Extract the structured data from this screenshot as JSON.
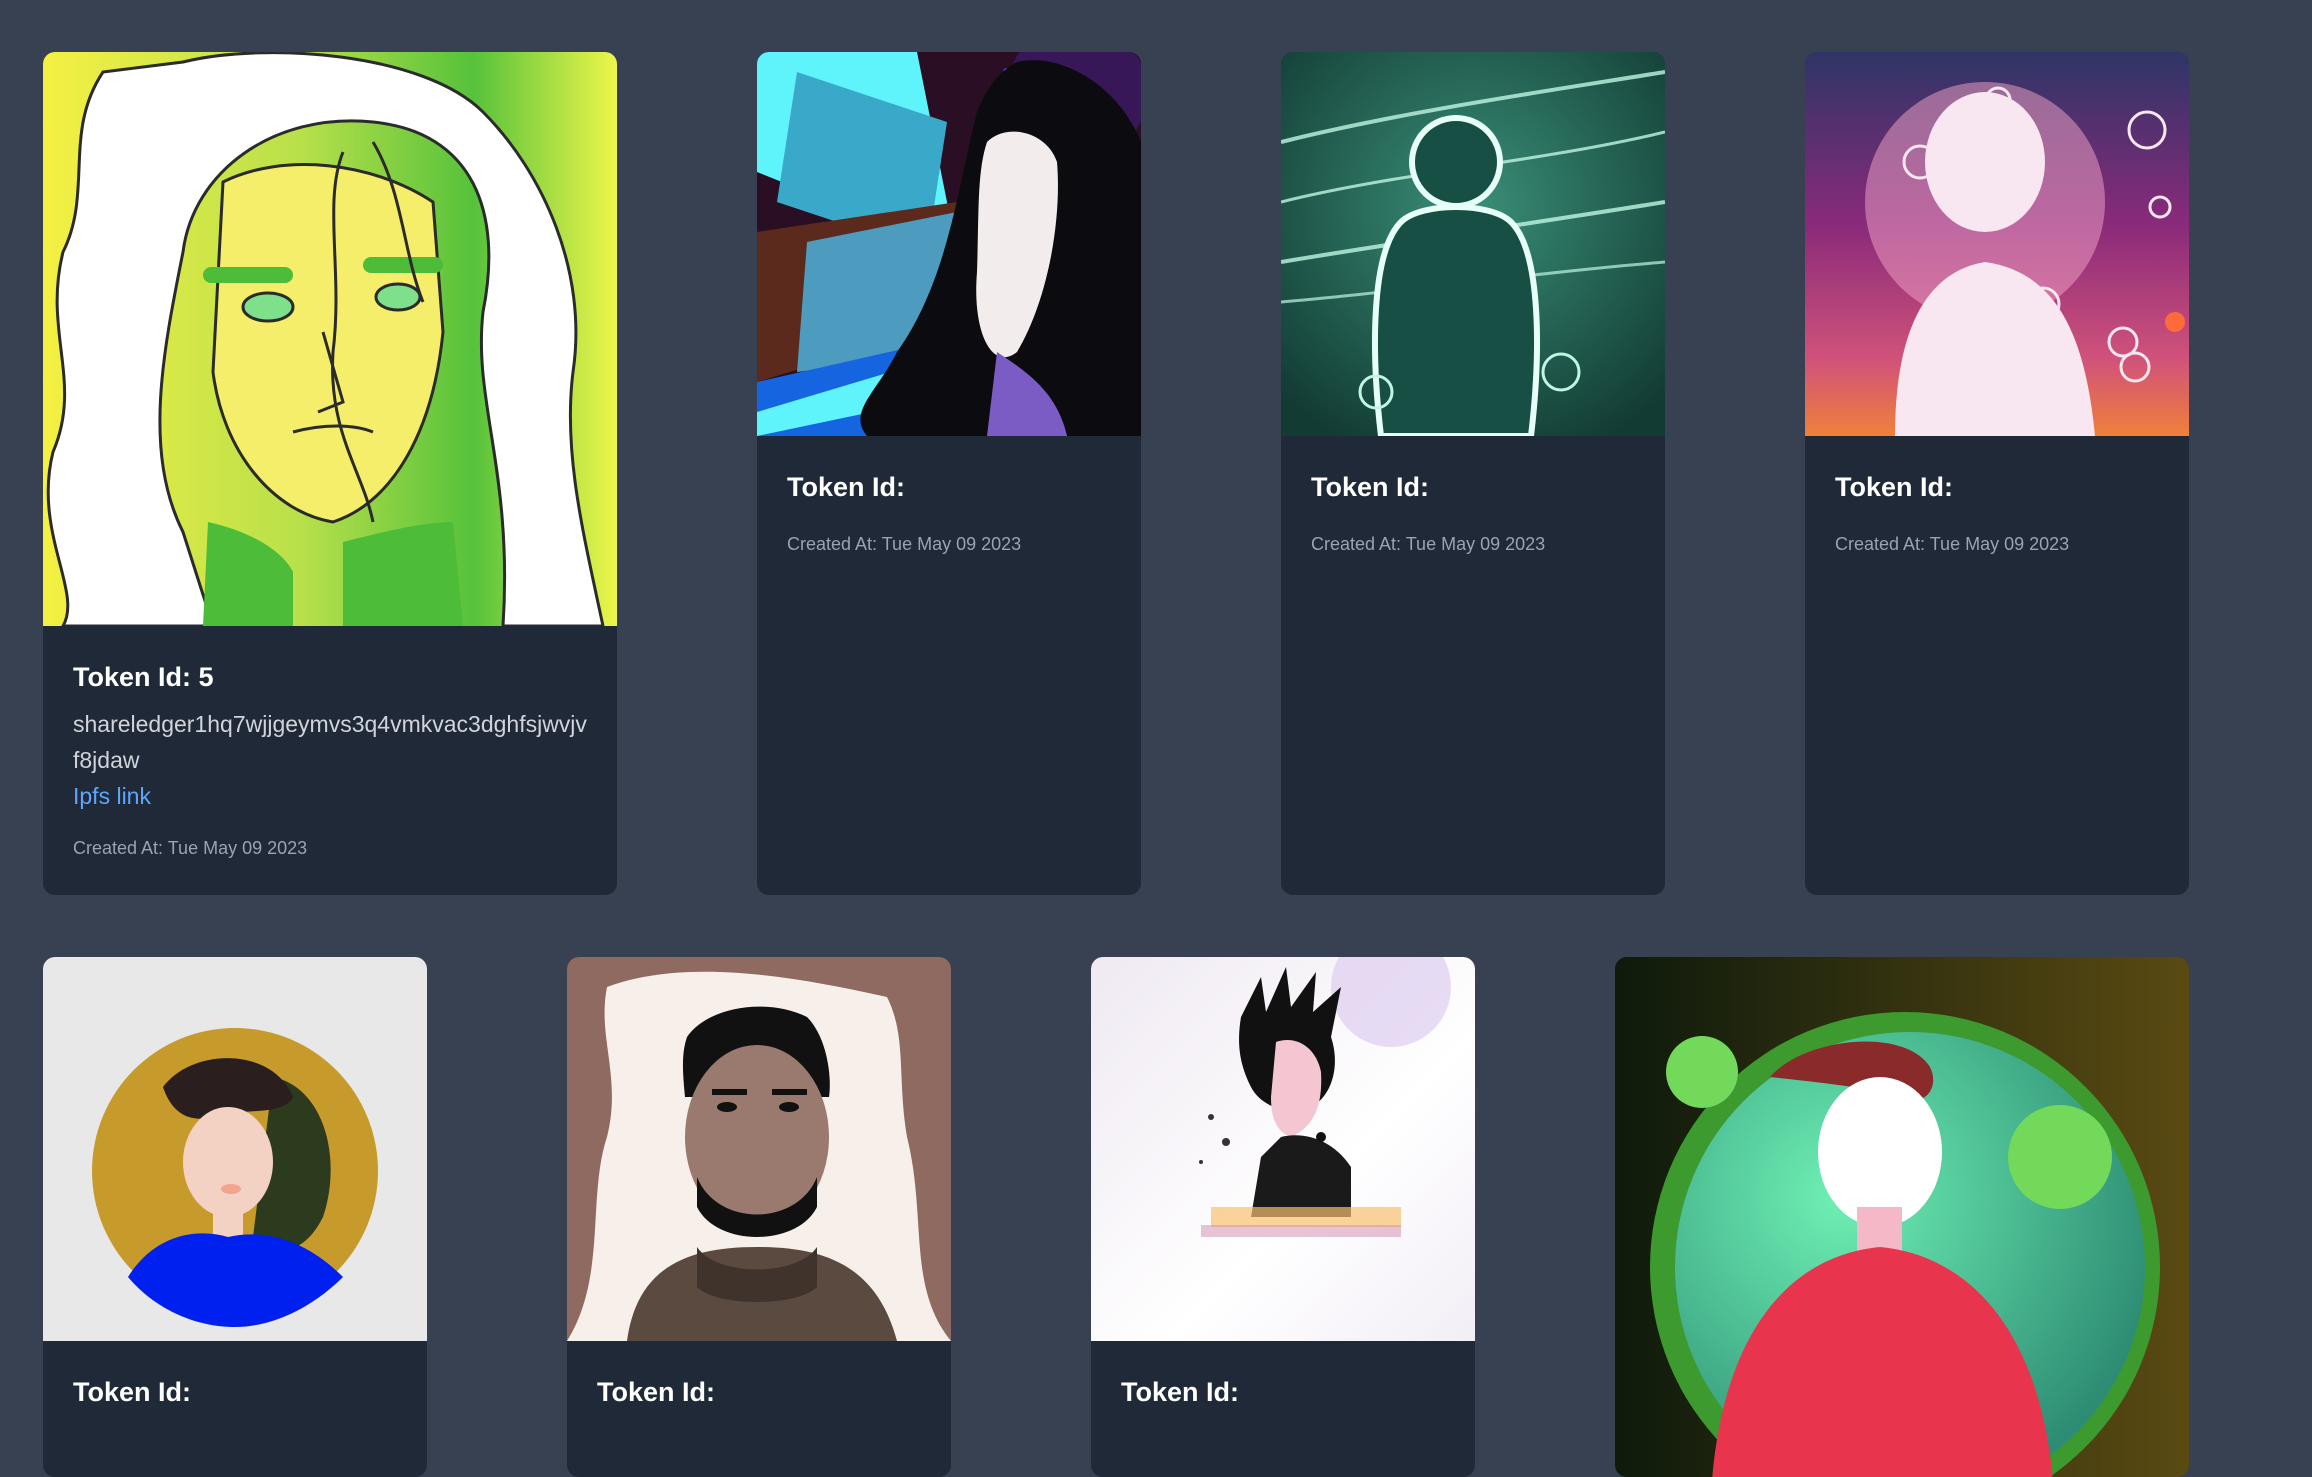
{
  "cards": [
    {
      "title": "Token Id: 5",
      "owner": "shareledger1hq7wjjgeymvs3q4vmkvac3dghfsjwvjvf8jdaw",
      "link": "Ipfs link",
      "created": "Created At: Tue May 09 2023",
      "image": "long-haired-portrait-art"
    },
    {
      "title": "Token Id:",
      "created": "Created At: Tue May 09 2023",
      "image": "anime-girl-art"
    },
    {
      "title": "Token Id:",
      "created": "Created At: Tue May 09 2023",
      "image": "glowing-silhouette-art"
    },
    {
      "title": "Token Id:",
      "created": "Created At: Tue May 09 2023",
      "image": "network-silhouette-art"
    },
    {
      "title": "Token Id:",
      "image": "circle-avatar-art"
    },
    {
      "title": "Token Id:",
      "image": "bearded-man-art"
    },
    {
      "title": "Token Id:",
      "image": "punk-portrait-art"
    },
    {
      "title": "",
      "image": "green-circle-avatar-art"
    }
  ]
}
